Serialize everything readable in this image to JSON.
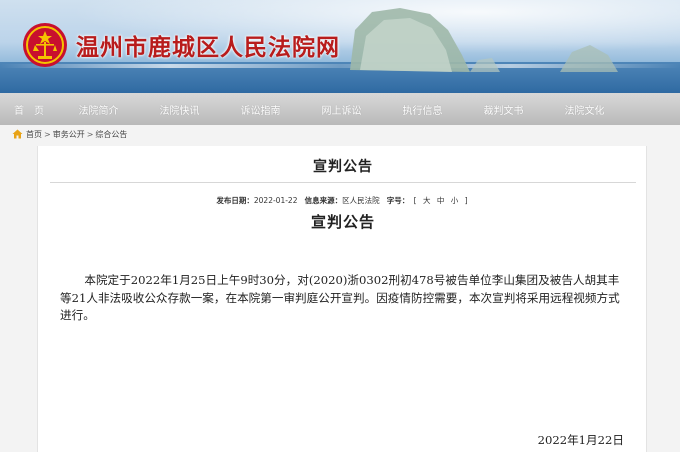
{
  "site": {
    "title": "温州市鹿城区人民法院网"
  },
  "nav": {
    "items": [
      "首　页",
      "法院简介",
      "法院快讯",
      "诉讼指南",
      "网上诉讼",
      "执行信息",
      "裁判文书",
      "法院文化"
    ]
  },
  "breadcrumb": {
    "items": [
      "首页",
      "审务公开",
      "综合公告"
    ],
    "separator": ">"
  },
  "article": {
    "title": "宣判公告",
    "meta": {
      "date_label": "发布日期：",
      "date": "2022-01-22",
      "source_label": "信息来源：",
      "source": "区人民法院",
      "fontsize_label": "字号：",
      "bracket_open": "[",
      "bracket_close": "]",
      "sizes": [
        "大",
        "中",
        "小"
      ]
    },
    "subtitle": "宣判公告",
    "body": "本院定于2022年1月25日上午9时30分，对(2020)浙0302刑初478号被告单位李山集团及被告人胡其丰等21人非法吸收公众存款一案，在本院第一审判庭公开宣判。因疫情防控需要，本次宣判将采用远程视频方式进行。",
    "signed_date": "2022年1月22日"
  },
  "colors": {
    "title_red": "#b81c1c",
    "nav_bg": "#c4c4c4",
    "page_bg": "#f3f3f3"
  },
  "icons": {
    "emblem": "court-emblem-icon",
    "home": "home-icon"
  }
}
